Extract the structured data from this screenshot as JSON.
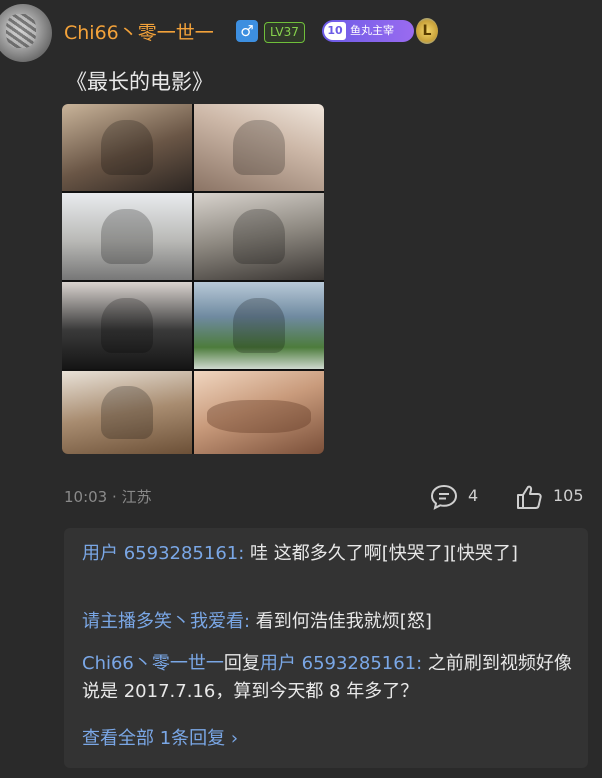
{
  "header": {
    "username": "Chi66丶零一世一",
    "gender_symbol": "♂",
    "level_label": "LV37",
    "fan_badge_level": "10",
    "fan_badge_name": "鱼丸主宰",
    "crest_letter": "L"
  },
  "post": {
    "title": "《最长的电影》",
    "image_count": 8
  },
  "meta": {
    "time": "10:03",
    "location": "江苏",
    "comment_count": "4",
    "like_count": "105"
  },
  "replies": [
    {
      "user": "用户 6593285161:",
      "text": " 哇 这都多久了啊[快哭了][快哭了]"
    },
    {
      "user": "请主播多笑丶我爱看:",
      "text": " 看到何浩佳我就烦[怒]"
    },
    {
      "user": "Chi66丶零一世一",
      "middle": "回复",
      "target": "用户 6593285161:",
      "text": " 之前刷到视频好像说是 2017.7.16，算到今天都 8 年多了？"
    }
  ],
  "view_all_label": "查看全部 1条回复 ›",
  "colors": {
    "background": "#2a2a2a",
    "username": "#f3a23a",
    "link_blue": "#7aa7e6",
    "meta_gray": "#8a8a8a"
  }
}
